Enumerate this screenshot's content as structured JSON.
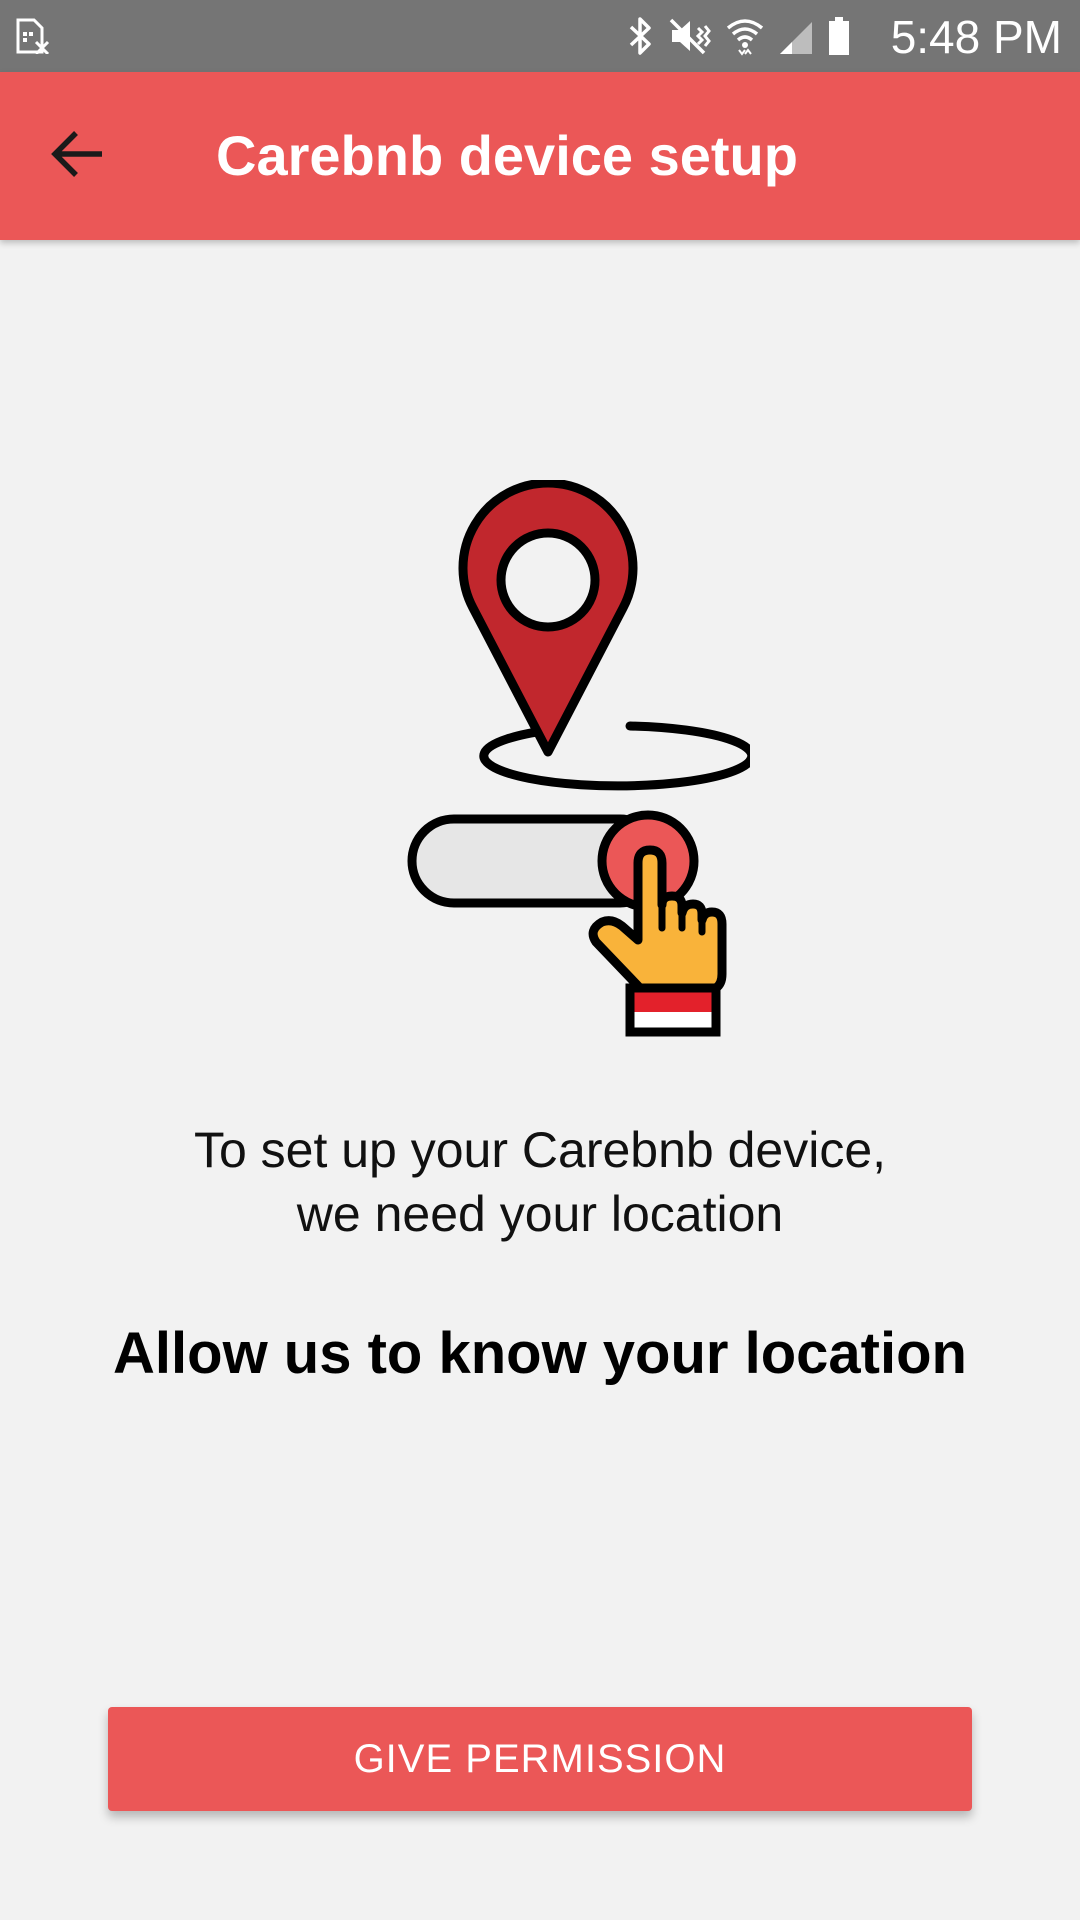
{
  "status_bar": {
    "time": "5:48 PM",
    "icons": [
      "sim-card-icon",
      "bluetooth-icon",
      "mute-icon",
      "wifi-icon",
      "cell-signal-icon",
      "battery-icon"
    ]
  },
  "app_bar": {
    "title": "Carebnb device setup",
    "back_icon": "arrow-left-icon",
    "color": "#eb5757"
  },
  "illustration": {
    "icon": "location-pin-toggle-icon",
    "pin_color": "#c1272d",
    "knob_color": "#eb5757",
    "hand_color": "#f9b33a"
  },
  "content": {
    "intro_line_1": "To set up your Carebnb device,",
    "intro_line_2": "we need your location",
    "heading": "Allow us to know your location"
  },
  "actions": {
    "give_permission_label": "GIVE PERMISSION"
  }
}
